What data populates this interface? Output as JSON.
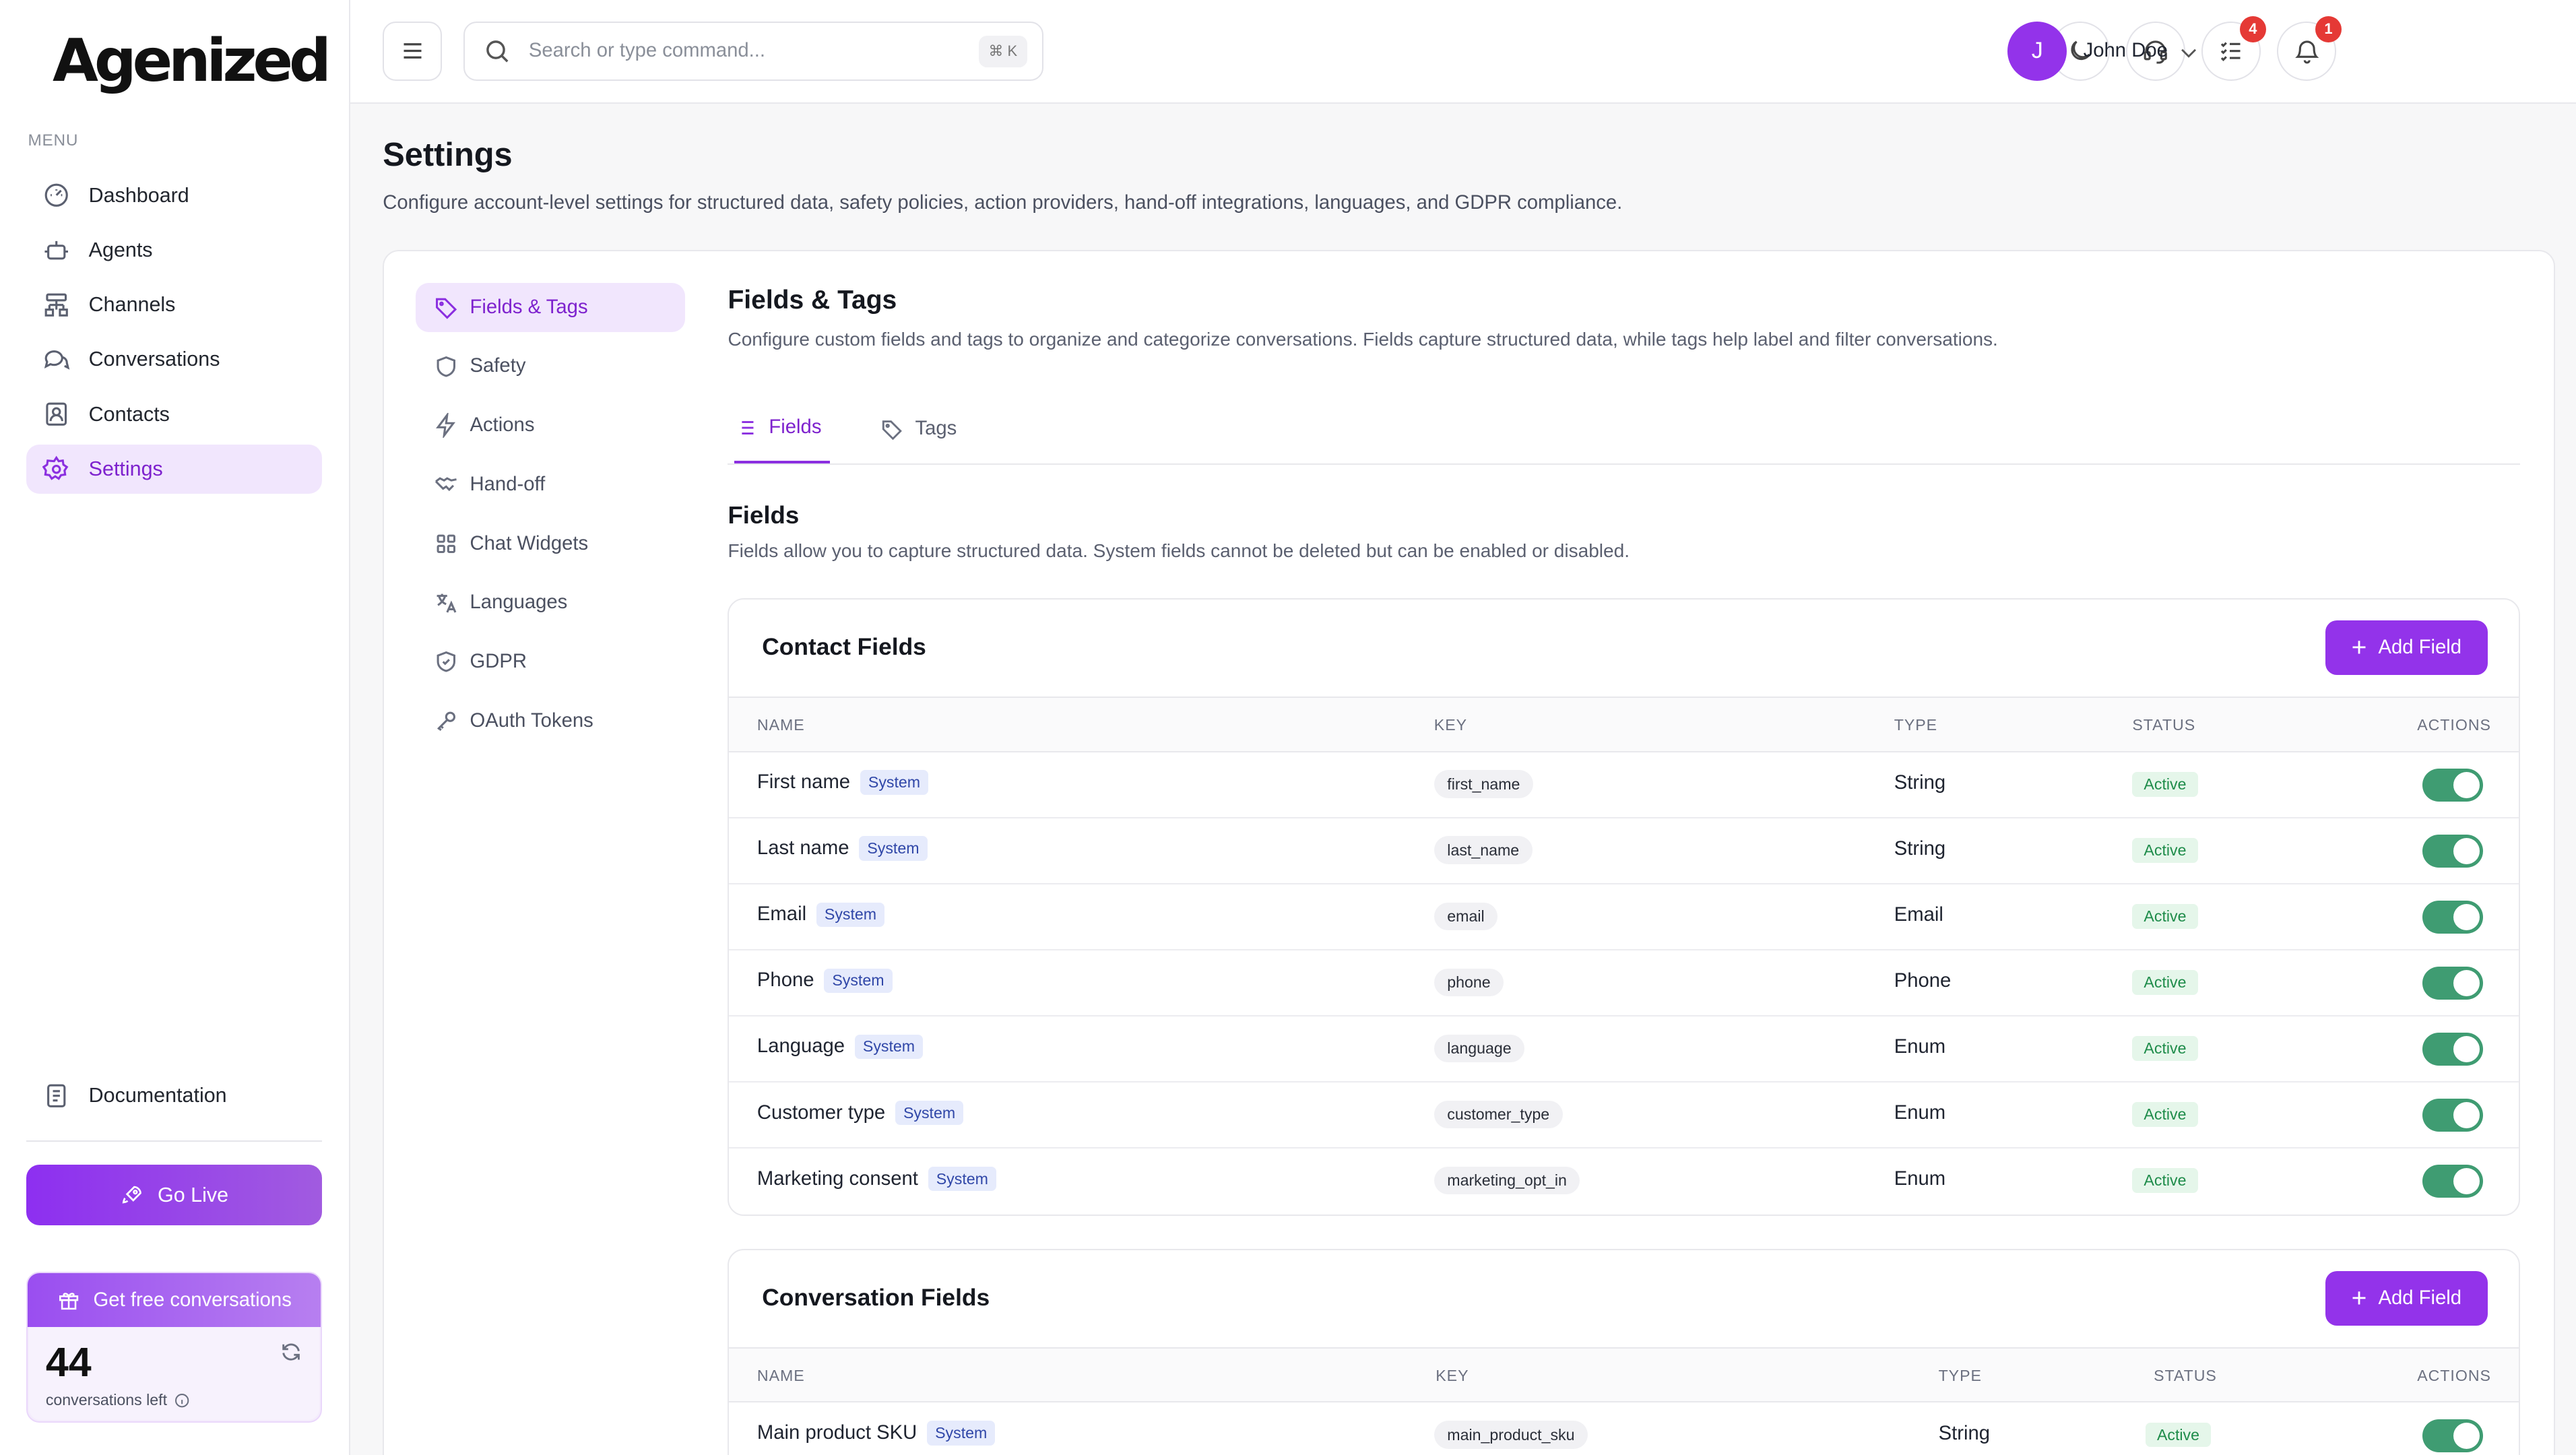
{
  "brand": {
    "logo_text": "Agenized",
    "accent": "#9333ea"
  },
  "sidebar": {
    "menu_label": "MENU",
    "items": [
      {
        "label": "Dashboard",
        "icon": "dashboard-icon"
      },
      {
        "label": "Agents",
        "icon": "bot-icon"
      },
      {
        "label": "Channels",
        "icon": "channels-icon"
      },
      {
        "label": "Conversations",
        "icon": "chat-icon"
      },
      {
        "label": "Contacts",
        "icon": "contacts-icon"
      },
      {
        "label": "Settings",
        "icon": "gear-icon",
        "active": true
      }
    ],
    "documentation": "Documentation",
    "go_live": "Go Live",
    "free_card": {
      "title": "Get free conversations",
      "count": "44",
      "subtitle": "conversations left"
    }
  },
  "header": {
    "search_placeholder": "Search or type command...",
    "shortcut": "⌘ K",
    "tasks_badge": "4",
    "notifications_badge": "1",
    "user": {
      "initial": "J",
      "name": "John Doe"
    }
  },
  "page": {
    "title": "Settings",
    "description": "Configure account-level settings for structured data, safety policies, action providers, hand-off integrations, languages, and GDPR compliance."
  },
  "subnav": [
    {
      "label": "Fields & Tags",
      "active": true
    },
    {
      "label": "Safety"
    },
    {
      "label": "Actions"
    },
    {
      "label": "Hand-off"
    },
    {
      "label": "Chat Widgets"
    },
    {
      "label": "Languages"
    },
    {
      "label": "GDPR"
    },
    {
      "label": "OAuth Tokens"
    }
  ],
  "section": {
    "title": "Fields & Tags",
    "description": "Configure custom fields and tags to organize and categorize conversations. Fields capture structured data, while tags help label and filter conversations.",
    "tabs": [
      {
        "label": "Fields",
        "active": true
      },
      {
        "label": "Tags"
      }
    ],
    "fields_title": "Fields",
    "fields_description": "Fields allow you to capture structured data. System fields cannot be deleted but can be enabled or disabled."
  },
  "columns": {
    "name": "NAME",
    "key": "KEY",
    "type": "TYPE",
    "status": "STATUS",
    "actions": "ACTIONS"
  },
  "contact_fields": {
    "title": "Contact Fields",
    "add_label": "Add Field",
    "rows": [
      {
        "name": "First name",
        "badge": "System",
        "key": "first_name",
        "type": "String",
        "status": "Active",
        "enabled": true
      },
      {
        "name": "Last name",
        "badge": "System",
        "key": "last_name",
        "type": "String",
        "status": "Active",
        "enabled": true
      },
      {
        "name": "Email",
        "badge": "System",
        "key": "email",
        "type": "Email",
        "status": "Active",
        "enabled": true
      },
      {
        "name": "Phone",
        "badge": "System",
        "key": "phone",
        "type": "Phone",
        "status": "Active",
        "enabled": true
      },
      {
        "name": "Language",
        "badge": "System",
        "key": "language",
        "type": "Enum",
        "status": "Active",
        "enabled": true
      },
      {
        "name": "Customer type",
        "badge": "System",
        "key": "customer_type",
        "type": "Enum",
        "status": "Active",
        "enabled": true
      },
      {
        "name": "Marketing consent",
        "badge": "System",
        "key": "marketing_opt_in",
        "type": "Enum",
        "status": "Active",
        "enabled": true
      }
    ]
  },
  "conversation_fields": {
    "title": "Conversation Fields",
    "add_label": "Add Field",
    "rows": [
      {
        "name": "Main product SKU",
        "badge": "System",
        "key": "main_product_sku",
        "type": "String",
        "status": "Active",
        "enabled": true
      }
    ]
  }
}
